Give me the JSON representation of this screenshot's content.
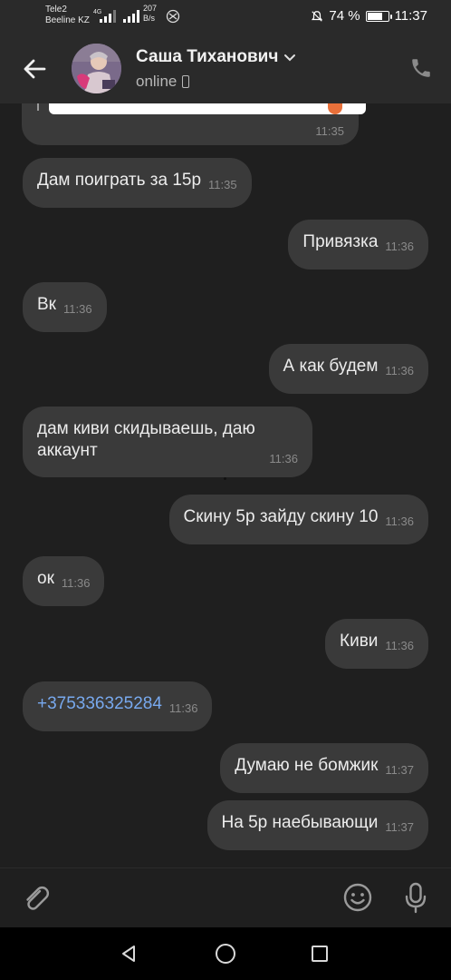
{
  "status_bar": {
    "carrier1": "Tele2",
    "carrier2": "Beeline KZ",
    "network": "4G",
    "speed_value": "207",
    "speed_unit": "B/s",
    "battery": "74 %",
    "battery_level": 0.74,
    "time": "11:37"
  },
  "header": {
    "contact_name": "Саша Тиханович",
    "status": "online"
  },
  "messages": [
    {
      "side": "in",
      "text": "",
      "time": "11:35",
      "partial": true
    },
    {
      "side": "in",
      "text": "Дам поиграть за 15р",
      "time": "11:35"
    },
    {
      "side": "out",
      "text": "Привязка",
      "time": "11:36"
    },
    {
      "side": "in",
      "text": "Вк",
      "time": "11:36"
    },
    {
      "side": "out",
      "text": "А как будем",
      "time": "11:36"
    },
    {
      "side": "in",
      "text": "дам киви скидываешь, даю аккаунт",
      "time": "11:36"
    },
    {
      "side": "out",
      "text": "Скину 5р зайду скину 10",
      "time": "11:36"
    },
    {
      "side": "in",
      "text": "ок",
      "time": "11:36"
    },
    {
      "side": "out",
      "text": "Киви",
      "time": "11:36"
    },
    {
      "side": "in",
      "text": "+375336325284",
      "time": "11:36",
      "link": true
    },
    {
      "side": "out",
      "text": "Думаю не бомжик",
      "time": "11:37"
    },
    {
      "side": "out",
      "text": "На 5р наебывающи",
      "time": "11:37"
    }
  ],
  "icons": {
    "back": "arrow-left-icon",
    "call": "phone-icon",
    "attach": "paperclip-icon",
    "emoji": "smiley-icon",
    "mic": "microphone-icon"
  },
  "colors": {
    "background": "#1f1f1f",
    "header": "#2a2a2a",
    "bubble": "#3a3a3a",
    "link": "#78a9ee"
  }
}
